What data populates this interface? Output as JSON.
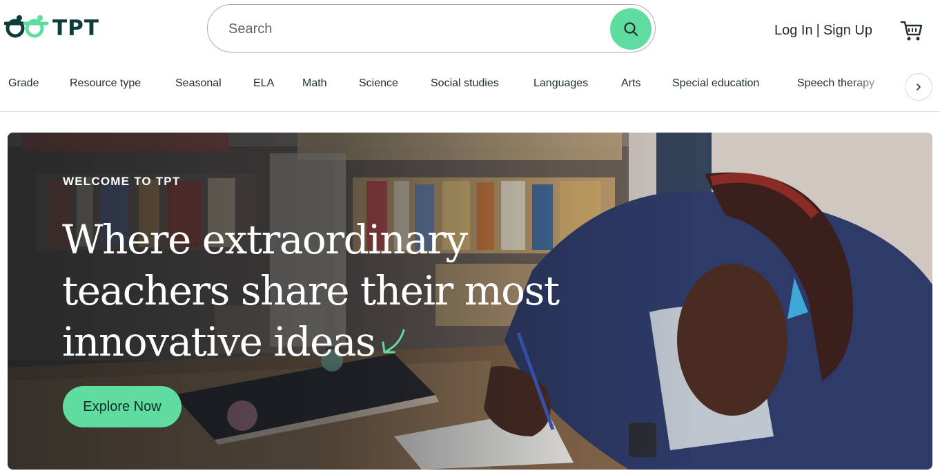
{
  "brand": {
    "name": "TPT",
    "accent": "#5fdc9f",
    "dark": "#0f3b3b"
  },
  "search": {
    "placeholder": "Search",
    "icon": "search-icon"
  },
  "auth": {
    "login": "Log In",
    "separator": "|",
    "signup": "Sign Up"
  },
  "cart": {
    "icon": "cart-icon"
  },
  "nav": {
    "items": [
      "Grade",
      "Resource type",
      "Seasonal",
      "ELA",
      "Math",
      "Science",
      "Social studies",
      "Languages",
      "Arts",
      "Special education",
      "Speech therapy"
    ],
    "next_icon": "chevron-right-icon"
  },
  "hero": {
    "eyebrow": "WELCOME TO TPT",
    "title_line1": "Where extraordinary",
    "title_line2": "teachers share their most",
    "title_line3": "innovative ideas",
    "cta": "Explore Now",
    "arrow_icon": "curved-arrow-icon"
  }
}
